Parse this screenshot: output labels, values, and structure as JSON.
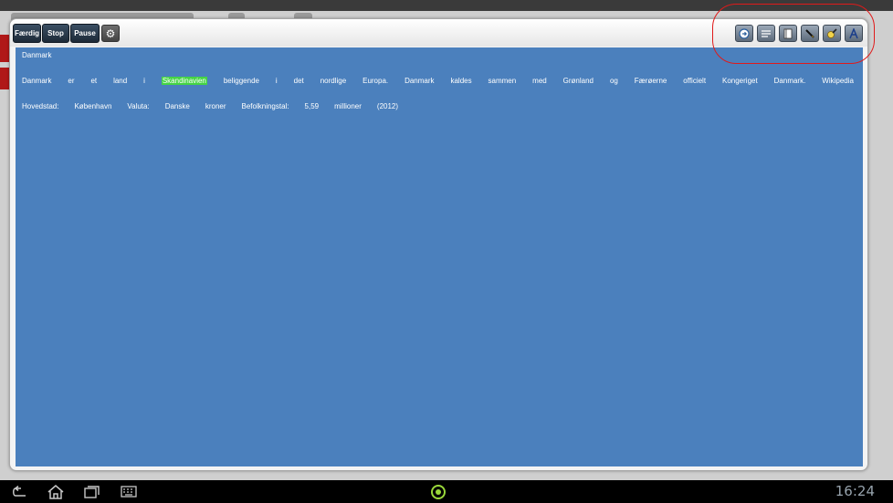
{
  "toolbar": {
    "finish_label": "Færdig",
    "stop_label": "Stop",
    "pause_label": "Pause",
    "settings_icon": "gear-icon",
    "tools": [
      {
        "icon": "circle-play-icon"
      },
      {
        "icon": "list-lines-icon"
      },
      {
        "icon": "book-icon"
      },
      {
        "icon": "pen-icon"
      },
      {
        "icon": "highlighter-icon"
      },
      {
        "icon": "font-a-icon"
      }
    ]
  },
  "document": {
    "title": "Danmark",
    "line1": [
      "Danmark",
      "er",
      "et",
      "land",
      "i",
      "Skandinavien",
      "beliggende",
      "i",
      "det",
      "nordlige",
      "Europa.",
      "Danmark",
      "kaldes",
      "sammen",
      "med",
      "Grønland",
      "og",
      "Færøerne",
      "officielt",
      "Kongeriget",
      "Danmark.",
      "Wikipedia"
    ],
    "line2": [
      "Hovedstad:",
      "København",
      "Valuta:",
      "Danske",
      "kroner",
      "Befolkningstal:",
      "5,59",
      "millioner",
      "(2012)"
    ],
    "highlighted_word": "Skandinavien",
    "highlight_color": "#45d445"
  },
  "navbar": {
    "clock": "16:24"
  },
  "colors": {
    "content_bg": "#4b80bd",
    "button_dark": "#1d2a38",
    "annotation": "#e01a1a"
  }
}
